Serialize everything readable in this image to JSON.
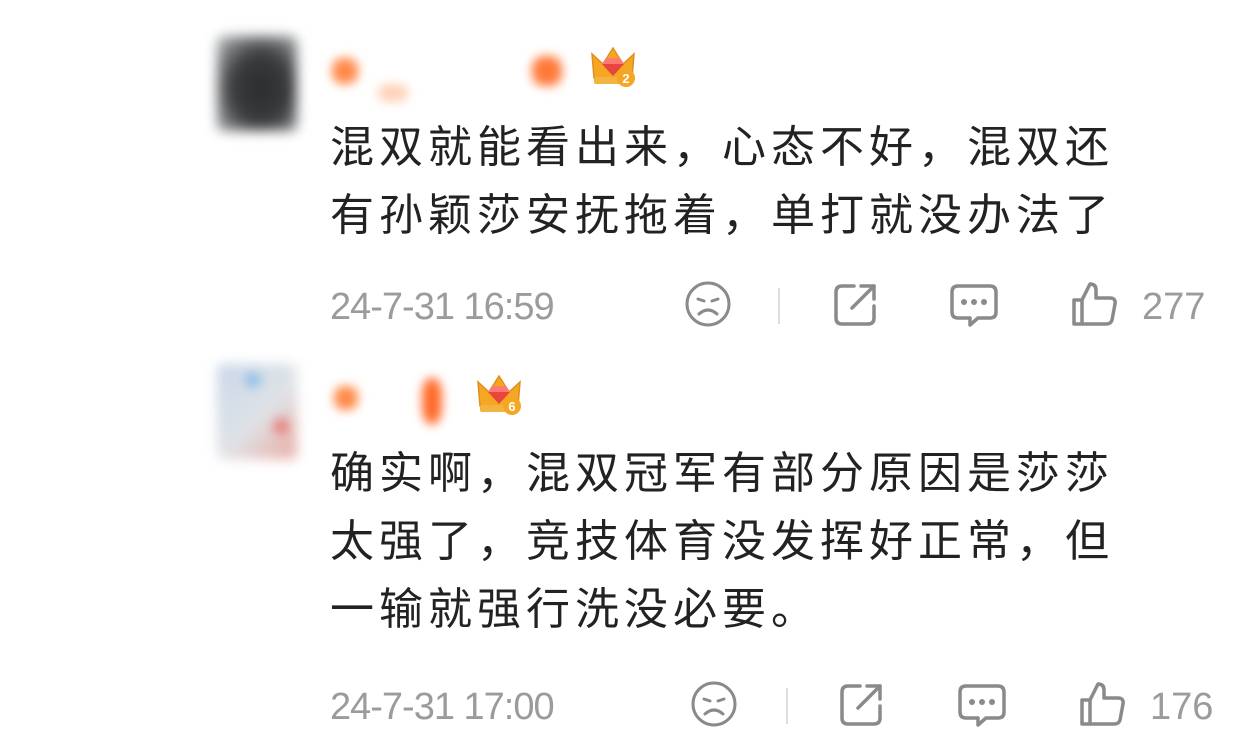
{
  "comments": [
    {
      "fan_level": "2",
      "text_lines": [
        "混双就能看出来，心态不好，混双还",
        "有孙颖莎安抚拖着，单打就没办法了"
      ],
      "timestamp": "24-7-31 16:59",
      "likes": "277",
      "icons": {
        "dislike": "sad-face-icon",
        "share": "share-icon",
        "reply": "comment-icon",
        "like": "thumbs-up-icon"
      }
    },
    {
      "fan_level": "6",
      "text_lines": [
        "确实啊，混双冠军有部分原因是莎莎",
        "太强了，竞技体育没发挥好正常，但",
        "一输就强行洗没必要。"
      ],
      "timestamp": "24-7-31 17:00",
      "likes": "176",
      "icons": {
        "dislike": "sad-face-icon",
        "share": "share-icon",
        "reply": "comment-icon",
        "like": "thumbs-up-icon"
      }
    }
  ],
  "colors": {
    "text": "#222222",
    "meta": "#9b9b9b",
    "crown": "#f5a623",
    "gem": "#e8453c"
  }
}
